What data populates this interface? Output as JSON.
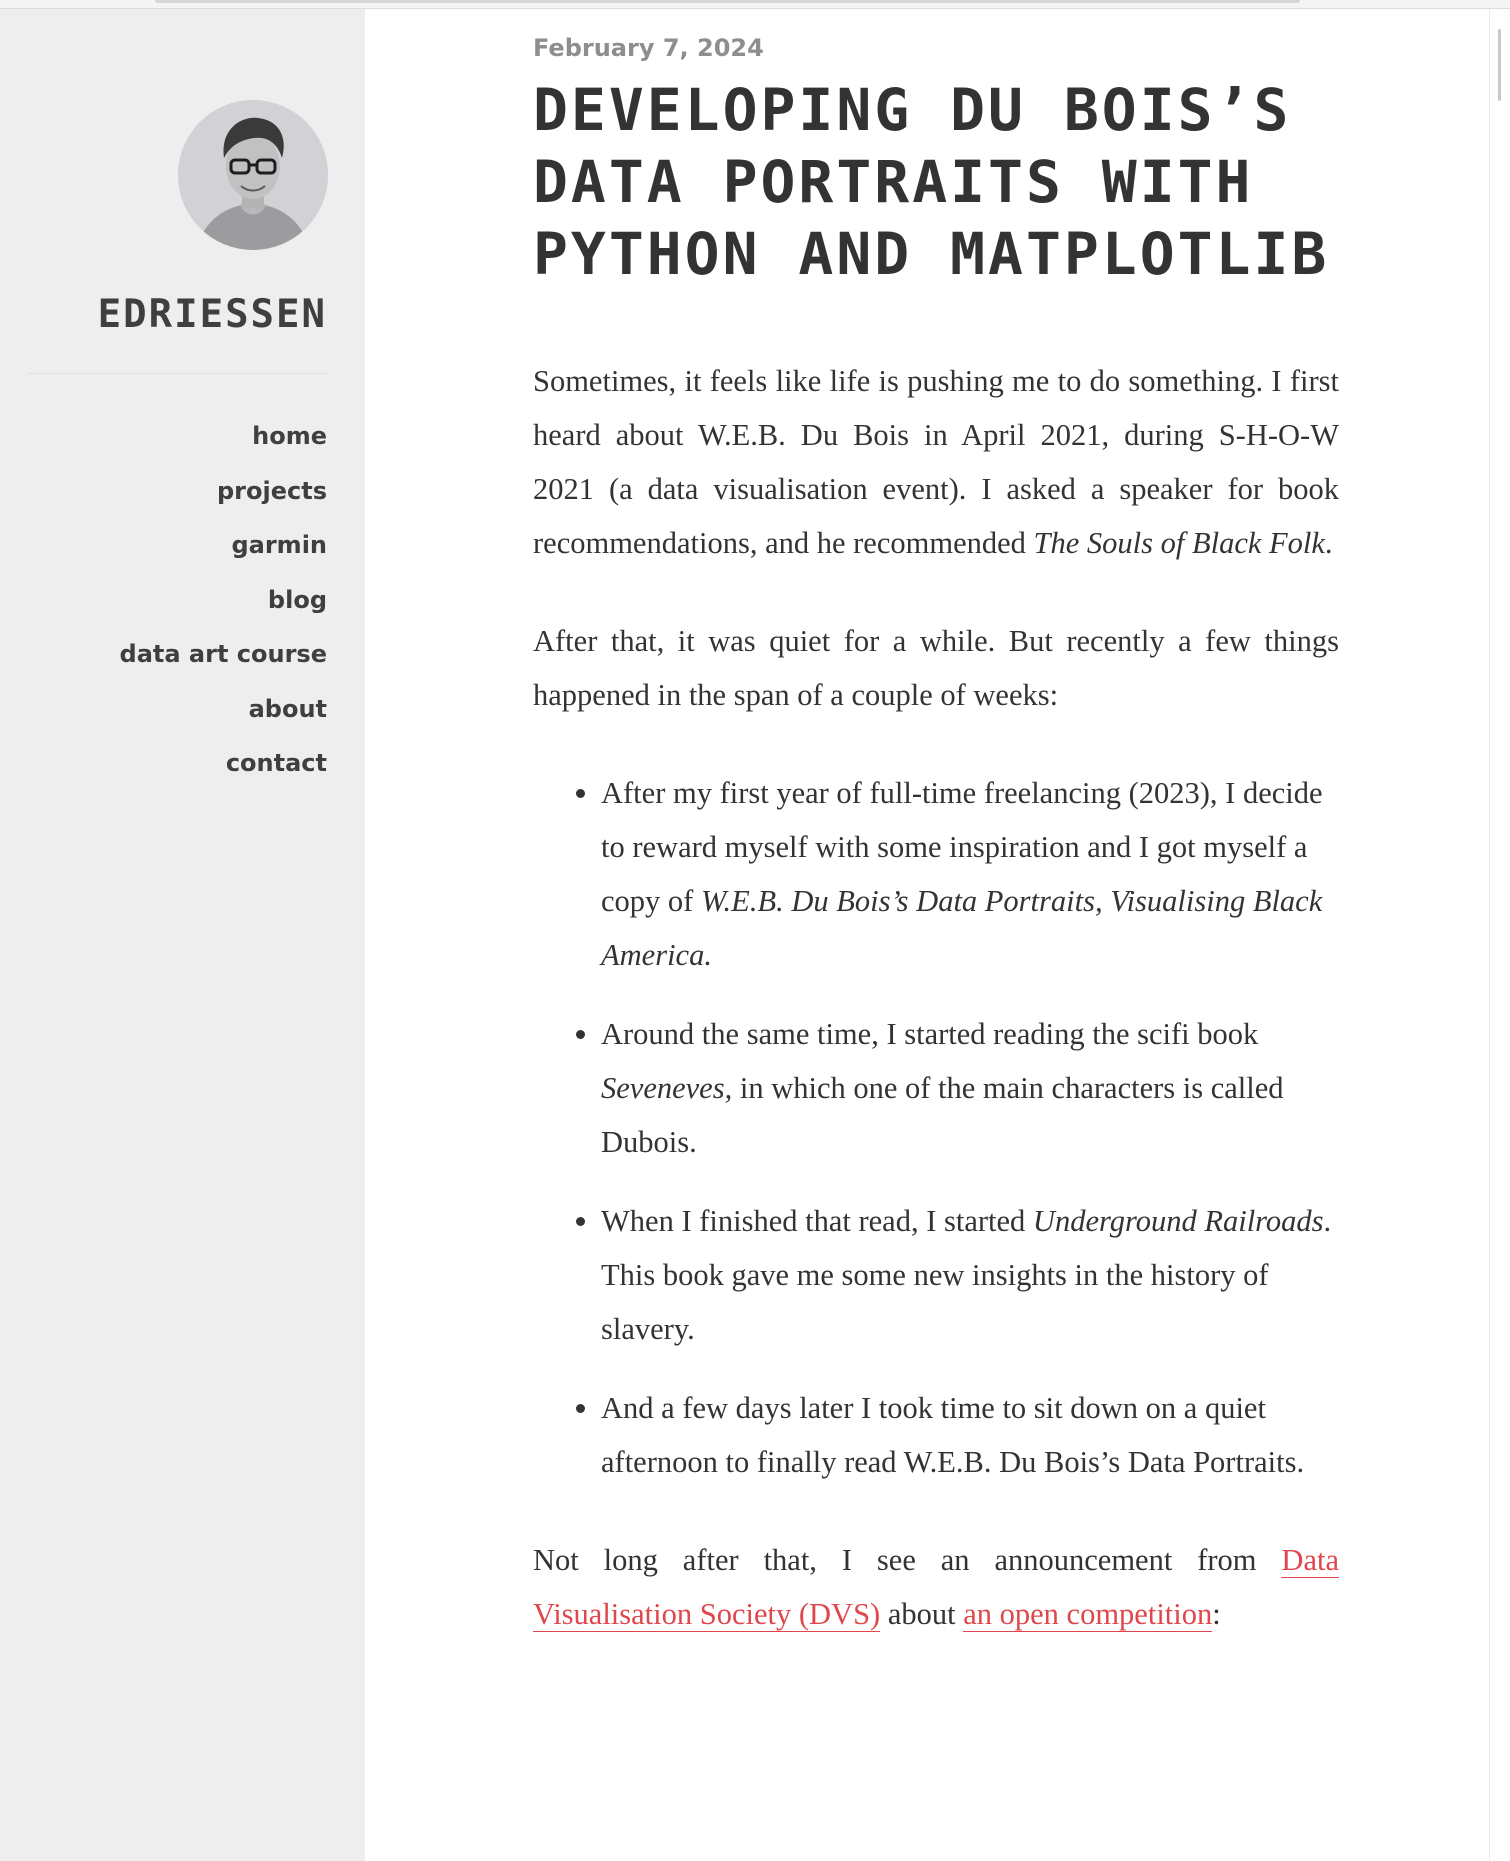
{
  "sidebar": {
    "site_title": "EDRIESSEN",
    "avatar_alt": "avatar",
    "nav": [
      {
        "label": "home"
      },
      {
        "label": "projects"
      },
      {
        "label": "garmin"
      },
      {
        "label": "blog"
      },
      {
        "label": "data art course"
      },
      {
        "label": "about"
      },
      {
        "label": "contact"
      }
    ]
  },
  "post": {
    "date": "February 7, 2024",
    "title": "DEVELOPING DU BOIS’S DATA PORTRAITS WITH PYTHON AND MATPLOTLIB",
    "p1": {
      "text": "Sometimes, it feels like life is pushing me to do something. I first heard about W.E.B. Du Bois in April 2021, during S-H-O-W 2021 (a data visualisation event). I asked a speaker for book recommendations, and he recommended ",
      "em": "The Souls of Black Folk",
      "end": "."
    },
    "p2": "After that, it was quiet for a while. But recently a few things happened in the span of a couple of weeks:",
    "bullets": [
      {
        "text": "After my first year of full-time freelancing (2023), I decide to reward myself with some inspiration and I got myself a copy of ",
        "em": "W.E.B. Du Bois’s Data Portraits, Visualising Black America.",
        "end": ""
      },
      {
        "pre": "Around the same time, I started reading the scifi book ",
        "em": "Seveneves,",
        "text": " in which one of the main characters is called Dubois."
      },
      {
        "pre": "When I finished that read, I started ",
        "em": "Underground Railroads",
        "text": ". This book gave me some new insights in the history of slavery."
      },
      {
        "text": "And a few days later I took time to sit down on a quiet afternoon to finally read W.E.B. Du Bois’s Data Portraits."
      }
    ],
    "p3": {
      "pre": "Not long after that, I see an announcement from ",
      "link1": "Data Visualisation Society (DVS)",
      "mid": " about ",
      "link2": "an open competition",
      "end": ":"
    }
  },
  "colors": {
    "sidebar_bg": "#eeeeee",
    "text": "#333333",
    "date": "#8e8e8e",
    "link": "#e0474c"
  }
}
